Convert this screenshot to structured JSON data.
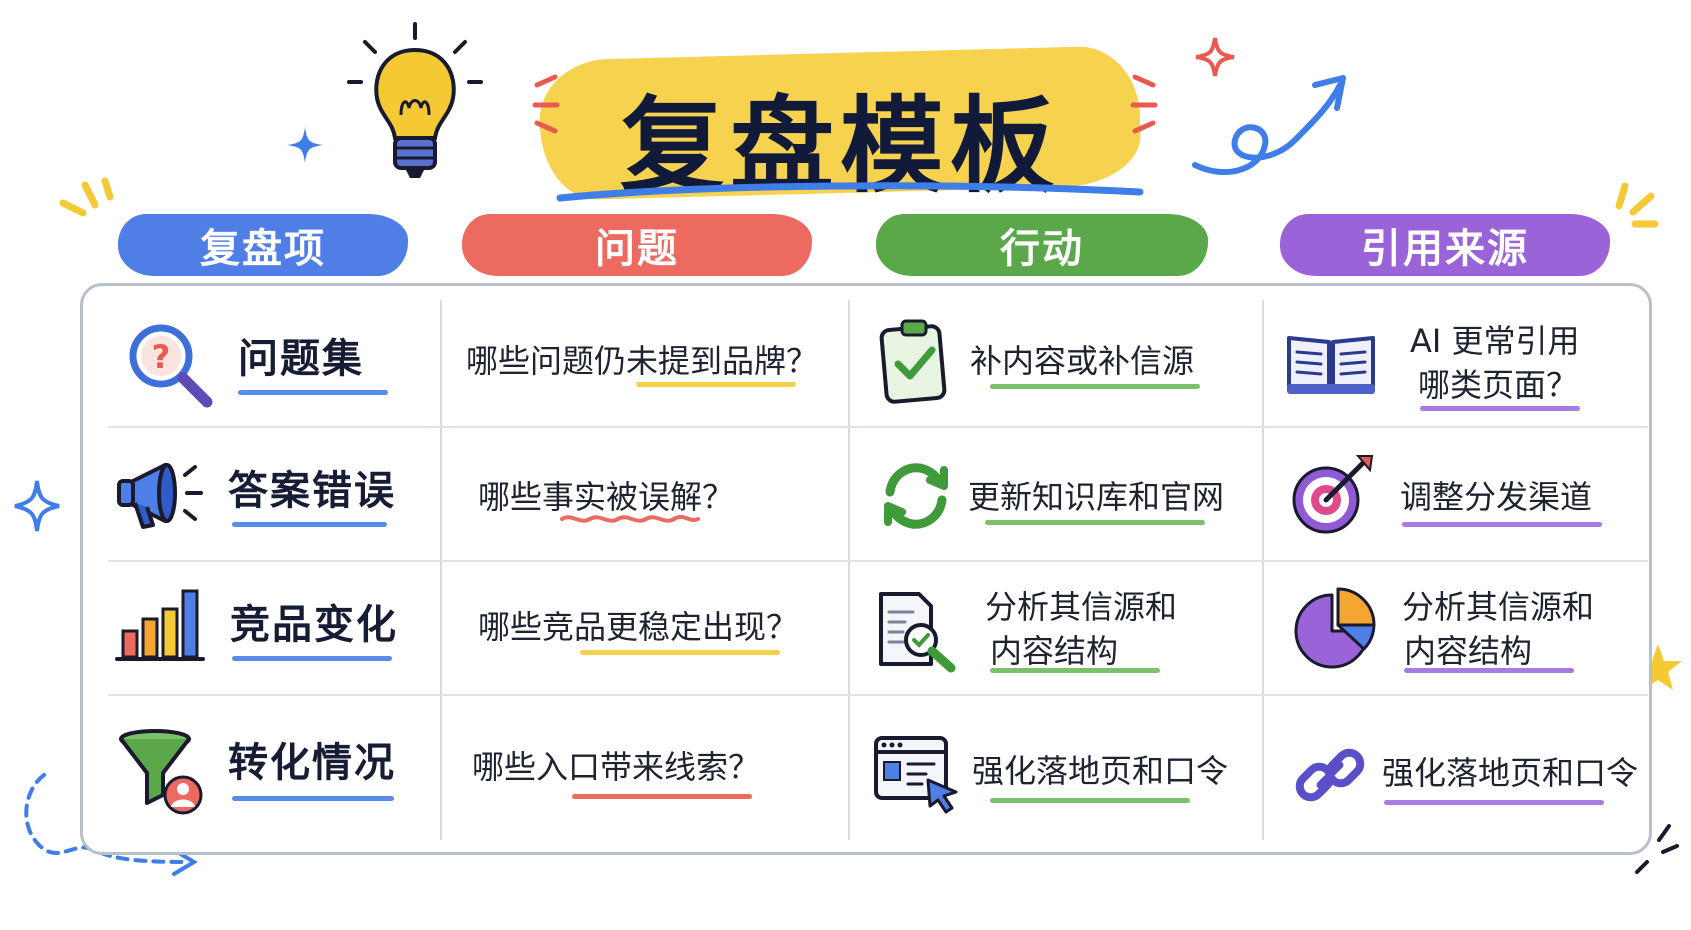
{
  "title": "复盘模板",
  "columns": [
    {
      "label": "复盘项",
      "color": "#4f7fe6"
    },
    {
      "label": "问题",
      "color": "#ec6a60"
    },
    {
      "label": "行动",
      "color": "#5aa84a"
    },
    {
      "label": "引用来源",
      "color": "#9a63d8"
    }
  ],
  "rows": [
    {
      "item": "问题集",
      "item_icon": "magnifier-question-icon",
      "question": "哪些问题仍未提到品牌？",
      "action": "补内容或补信源",
      "action_icon": "clipboard-check-icon",
      "source_line1": "AI 更常引用",
      "source_line2": "哪类页面？",
      "source_icon": "open-book-icon"
    },
    {
      "item": "答案错误",
      "item_icon": "megaphone-icon",
      "question": "哪些事实被误解？",
      "action": "更新知识库和官网",
      "action_icon": "refresh-arrows-icon",
      "source_line1": "调整分发渠道",
      "source_line2": "",
      "source_icon": "target-dart-icon"
    },
    {
      "item": "竞品变化",
      "item_icon": "bar-chart-icon",
      "question": "哪些竞品更稳定出现？",
      "action_line1": "分析其信源和",
      "action_line2": "内容结构",
      "action_icon": "document-search-icon",
      "source_line1": "分析其信源和",
      "source_line2": "内容结构",
      "source_icon": "pie-chart-icon"
    },
    {
      "item": "转化情况",
      "item_icon": "funnel-user-icon",
      "question": "哪些入口带来线索？",
      "action": "强化落地页和口令",
      "action_icon": "browser-cursor-icon",
      "source_line1": "强化落地页和口令",
      "source_line2": "",
      "source_icon": "chain-link-icon"
    }
  ]
}
